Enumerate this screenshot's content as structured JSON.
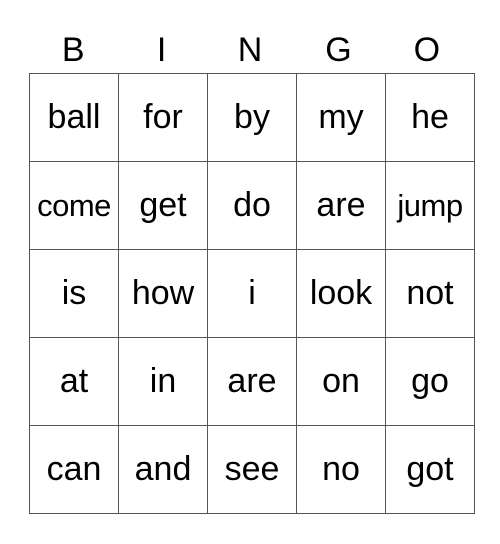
{
  "header": [
    "B",
    "I",
    "N",
    "G",
    "O"
  ],
  "rows": [
    [
      "ball",
      "for",
      "by",
      "my",
      "he"
    ],
    [
      "come",
      "get",
      "do",
      "are",
      "jump"
    ],
    [
      "is",
      "how",
      "i",
      "look",
      "not"
    ],
    [
      "at",
      "in",
      "are",
      "on",
      "go"
    ],
    [
      "can",
      "and",
      "see",
      "no",
      "got"
    ]
  ]
}
